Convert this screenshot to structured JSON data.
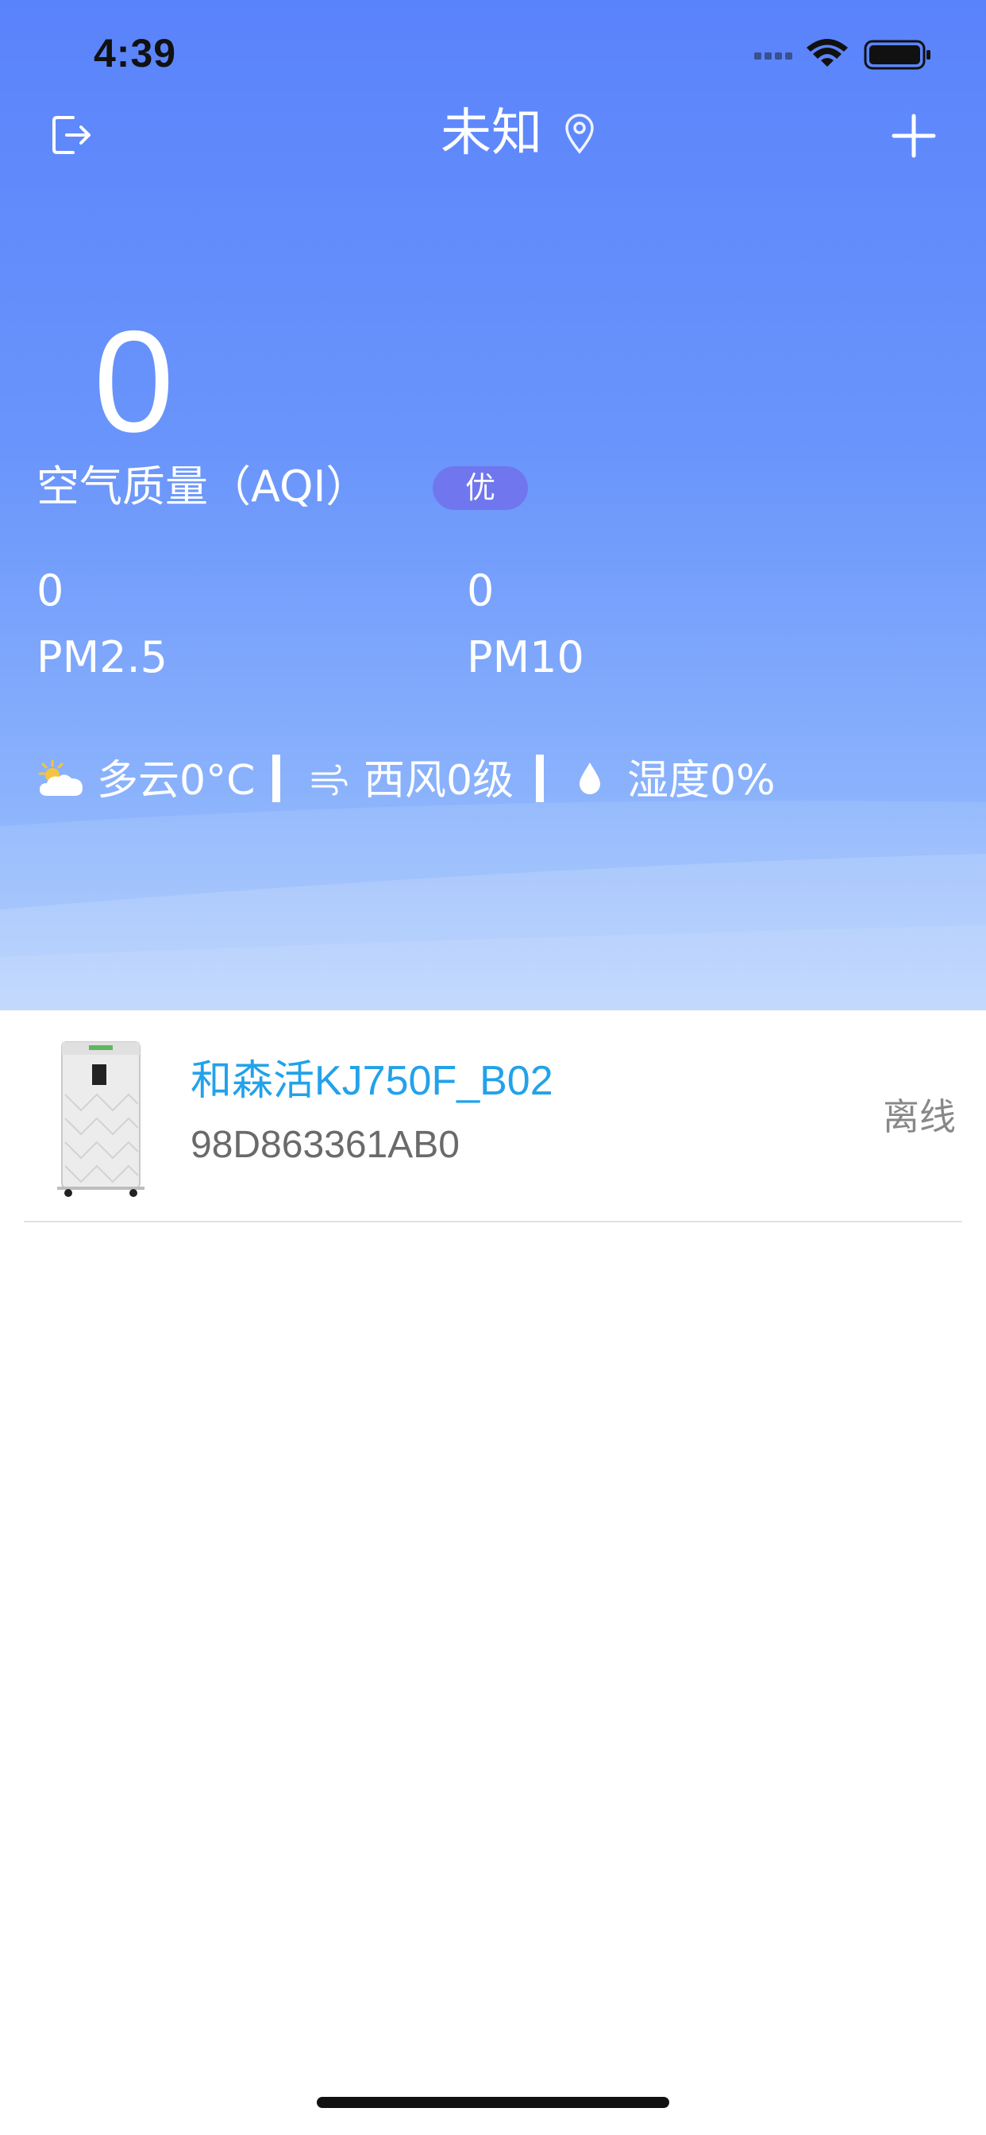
{
  "status_bar": {
    "time": "4:39"
  },
  "nav": {
    "title": "未知"
  },
  "air_quality": {
    "aqi_value": "0",
    "aqi_label": "空气质量（AQI）",
    "aqi_level": "优",
    "pm25_value": "0",
    "pm25_label": "PM2.5",
    "pm10_value": "0",
    "pm10_label": "PM10"
  },
  "weather": {
    "condition": "多云0°C",
    "wind": "西风0级",
    "humidity": "湿度0%"
  },
  "devices": [
    {
      "name": "和森活KJ750F_B02",
      "id": "98D863361AB0",
      "status": "离线"
    }
  ],
  "icons": {
    "exit": "exit-icon",
    "location": "location-pin-icon",
    "add": "plus-icon",
    "weather": "partly-cloudy-icon",
    "wind": "wind-icon",
    "humidity": "water-drop-icon"
  },
  "colors": {
    "header_top": "#5a83fb",
    "header_bottom": "#a9cafd",
    "aqi_badge": "#6f76ee",
    "device_name": "#22a2ea",
    "status_text": "#888888"
  }
}
